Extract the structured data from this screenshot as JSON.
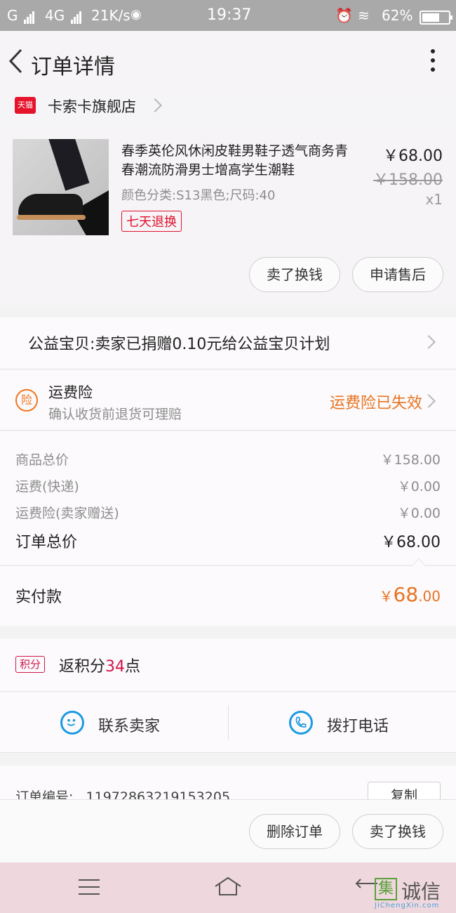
{
  "status_bar": {
    "carrier": "G",
    "network": "4G",
    "speed": "21K/s",
    "time": "19:37",
    "battery": "62%"
  },
  "header": {
    "title": "订单详情"
  },
  "shop": {
    "badge": "天猫",
    "name": "卡索卡旗舰店"
  },
  "product": {
    "title": "春季英伦风休闲皮鞋男鞋子透气商务青春潮流防滑男士增高学生潮鞋",
    "spec": "颜色分类:S13黑色;尺码:40",
    "return_badge": "七天退换",
    "price": "￥68.00",
    "original_price": "￥158.00",
    "quantity": "x1",
    "sell_button": "卖了换钱",
    "after_sale_button": "申请售后"
  },
  "charity": {
    "text": "公益宝贝:卖家已捐赠0.10元给公益宝贝计划"
  },
  "insurance": {
    "icon_text": "险",
    "title": "运费险",
    "subtitle": "确认收货前退货可理赔",
    "status": "运费险已失效"
  },
  "summary": {
    "rows": [
      {
        "label": "商品总价",
        "value": "￥158.00"
      },
      {
        "label": "运费(快递)",
        "value": "￥0.00"
      },
      {
        "label": "运费险(卖家赠送)",
        "value": "￥0.00"
      }
    ],
    "total_label": "订单总价",
    "total_value": "￥68.00"
  },
  "payment": {
    "label": "实付款",
    "symbol": "￥",
    "integer": "68",
    "decimal": ".00"
  },
  "points": {
    "badge": "积分",
    "prefix": "返积分",
    "value": "34",
    "suffix": "点"
  },
  "contact": {
    "seller_label": "联系卖家",
    "phone_label": "拨打电话"
  },
  "order_info": {
    "number_label": "订单编号:",
    "number_value": "1197286321915320​5",
    "copy_button": "复制"
  },
  "actions": {
    "delete_button": "删除订单",
    "sell_button": "卖了换钱"
  },
  "watermark": {
    "box": "集",
    "name": "诚信",
    "url": "JiChengXin.com"
  },
  "colors": {
    "accent_orange": "#e8731f",
    "tmall_red": "#e6142b",
    "points_red": "#d01647",
    "contact_blue": "#1b9ae2"
  },
  "icons": {
    "back": "back-chevron-icon",
    "more": "more-vertical-icon",
    "shop": "tmall-icon",
    "insurance": "insurance-icon",
    "points": "points-icon",
    "chat": "chat-face-icon",
    "phone": "phone-icon"
  }
}
